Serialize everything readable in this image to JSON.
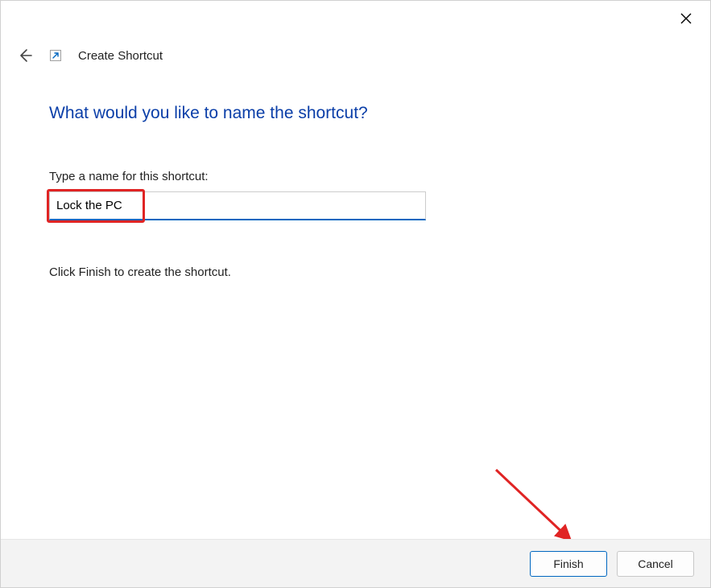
{
  "window": {
    "wizard_title": "Create Shortcut"
  },
  "content": {
    "question": "What would you like to name the shortcut?",
    "input_label": "Type a name for this shortcut:",
    "input_value": "Lock the PC",
    "instruction": "Click Finish to create the shortcut."
  },
  "footer": {
    "finish_label": "Finish",
    "cancel_label": "Cancel"
  },
  "annotation": {
    "highlight_color": "#e02424",
    "arrow_color": "#e02424"
  }
}
